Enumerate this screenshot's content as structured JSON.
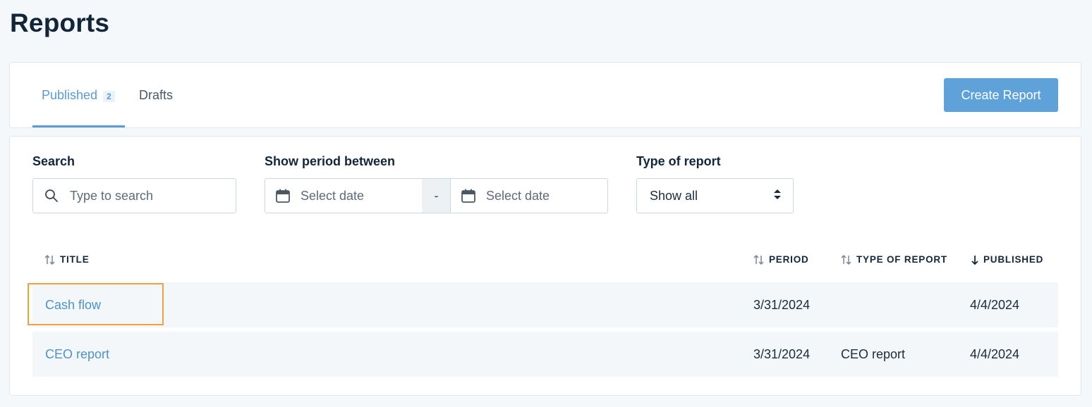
{
  "page": {
    "title": "Reports"
  },
  "tabs": [
    {
      "label": "Published",
      "badge": "2",
      "active": true
    },
    {
      "label": "Drafts",
      "active": false
    }
  ],
  "actions": {
    "create_label": "Create Report"
  },
  "filters": {
    "search": {
      "label": "Search",
      "placeholder": "Type to search",
      "icon": "search-icon"
    },
    "period": {
      "label": "Show period between",
      "from_placeholder": "Select date",
      "separator": "-",
      "to_placeholder": "Select date",
      "icon": "calendar-icon"
    },
    "type": {
      "label": "Type of report",
      "value": "Show all"
    }
  },
  "table": {
    "headers": [
      {
        "label": "TITLE",
        "sort": "unsorted"
      },
      {
        "label": "PERIOD",
        "sort": "unsorted"
      },
      {
        "label": "TYPE OF REPORT",
        "sort": "unsorted"
      },
      {
        "label": "PUBLISHED",
        "sort": "descending"
      }
    ],
    "rows": [
      {
        "title": "Cash flow",
        "period": "3/31/2024",
        "type": "",
        "published": "4/4/2024",
        "highlighted": true
      },
      {
        "title": "CEO report",
        "period": "3/31/2024",
        "type": "CEO report",
        "published": "4/4/2024",
        "highlighted": false
      }
    ]
  },
  "colors": {
    "accent": "#5a9bd5",
    "button": "#5fa2da",
    "highlight": "#f0a23a",
    "row_bg": "#f4f7fa"
  }
}
